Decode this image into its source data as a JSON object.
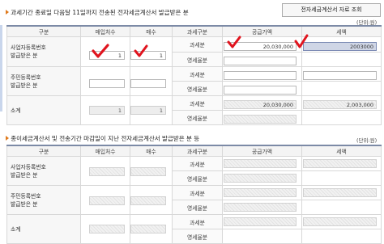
{
  "section1": {
    "title": "과세기간 종료일 다음달 11일까지 전송된 전자세금계산서 발급받은 분",
    "button": "전자세금계산서 자료 조회",
    "unit": "(단위:원)",
    "headers": [
      "구분",
      "매입처수",
      "매수",
      "과세구분",
      "공급가액",
      "세액"
    ],
    "rows": [
      {
        "label": "사업자등록번호\n발급받은 분",
        "vendors": "1",
        "count": "1",
        "taxable": {
          "kind": "과세분",
          "supply": "20,030,000",
          "tax": "2003000"
        },
        "zero": {
          "kind": "영세율분",
          "supply": "",
          "tax": ""
        }
      },
      {
        "label": "주민등록번호\n발급받은 분",
        "vendors": "",
        "count": "",
        "taxable": {
          "kind": "과세분",
          "supply": "",
          "tax": ""
        },
        "zero": {
          "kind": "영세율분",
          "supply": "",
          "tax": ""
        }
      },
      {
        "label": "소계",
        "vendors": "1",
        "count": "1",
        "taxable": {
          "kind": "과세분",
          "supply": "20,030,000",
          "tax": "2,003,000"
        },
        "zero": {
          "kind": "영세율분",
          "supply": "",
          "tax": ""
        }
      }
    ]
  },
  "section2": {
    "title": "종이세금계산서 및 전송기간 마감일이 지난 전자세금계산서 발급받은 분 등",
    "unit": "(단위:원)",
    "headers": [
      "구분",
      "매입처수",
      "매수",
      "과세구분",
      "공급가액",
      "세액"
    ],
    "rows": [
      {
        "label": "사업자등록번호\n발급받은 분",
        "kinds": [
          "과세분",
          "영세율분"
        ]
      },
      {
        "label": "주민등록번호\n발급받은 분",
        "kinds": [
          "과세분",
          "영세율분"
        ]
      },
      {
        "label": "소계",
        "kinds": [
          "과세분",
          "영세율분"
        ]
      }
    ]
  },
  "colors": {
    "accent_bar": "#7c8aa6",
    "check_red": "#e0141e",
    "bullet": "#e07a1c"
  }
}
